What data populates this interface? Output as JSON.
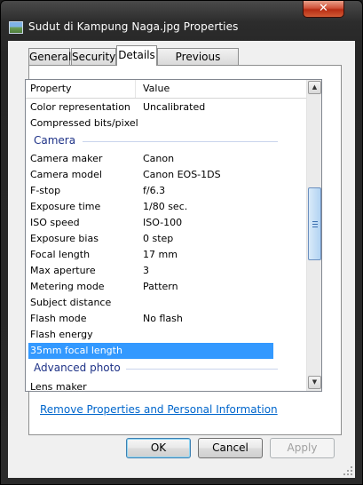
{
  "window": {
    "title": "Sudut di Kampung Naga.jpg Properties",
    "close_label": "✕"
  },
  "tabs": [
    {
      "label": "General"
    },
    {
      "label": "Security"
    },
    {
      "label": "Details"
    },
    {
      "label": "Previous Versions"
    }
  ],
  "table": {
    "headers": {
      "property": "Property",
      "value": "Value"
    },
    "rows_top": [
      {
        "property": "Color representation",
        "value": "Uncalibrated"
      },
      {
        "property": "Compressed bits/pixel",
        "value": ""
      }
    ],
    "group_camera": "Camera",
    "rows_camera": [
      {
        "property": "Camera maker",
        "value": "Canon"
      },
      {
        "property": "Camera model",
        "value": "Canon EOS-1DS"
      },
      {
        "property": "F-stop",
        "value": "f/6.3"
      },
      {
        "property": "Exposure time",
        "value": "1/80 sec."
      },
      {
        "property": "ISO speed",
        "value": "ISO-100"
      },
      {
        "property": "Exposure bias",
        "value": "0 step"
      },
      {
        "property": "Focal length",
        "value": "17 mm"
      },
      {
        "property": "Max aperture",
        "value": "3"
      },
      {
        "property": "Metering mode",
        "value": "Pattern"
      },
      {
        "property": "Subject distance",
        "value": ""
      },
      {
        "property": "Flash mode",
        "value": "No flash"
      },
      {
        "property": "Flash energy",
        "value": ""
      },
      {
        "property": "35mm focal length",
        "value": ""
      }
    ],
    "group_advanced": "Advanced photo",
    "rows_advanced": [
      {
        "property": "Lens maker",
        "value": ""
      }
    ]
  },
  "scrollbar": {
    "up_arrow": "▲",
    "down_arrow": "▼"
  },
  "link_text": "Remove Properties and Personal Information",
  "buttons": {
    "ok": "OK",
    "cancel": "Cancel",
    "apply": "Apply"
  },
  "colors": {
    "selection": "#3399ff",
    "group_text": "#1e3287",
    "link": "#0066cc"
  }
}
